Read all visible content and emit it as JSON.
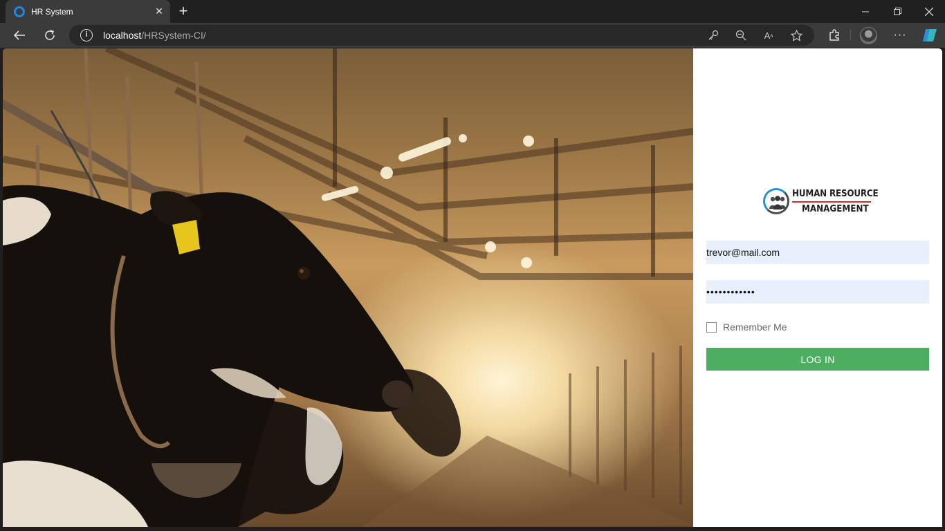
{
  "browser": {
    "tab_title": "HR System",
    "tab_close_icon": "close-icon",
    "new_tab_icon": "plus-icon",
    "url_host": "localhost",
    "url_path": "/HRSystem-CI/"
  },
  "logo": {
    "line1": "HUMAN RESOURCE",
    "line2": "MANAGEMENT"
  },
  "login": {
    "email_value": "trevor@mail.com",
    "password_value": "••••••••••••",
    "remember_label": "Remember Me",
    "remember_checked": false,
    "submit_label": "LOG IN"
  },
  "colors": {
    "accent_green": "#4caf60",
    "input_bg": "#e8f0fe",
    "logo_blue": "#2a8fd6",
    "logo_red": "#d32f2f"
  }
}
